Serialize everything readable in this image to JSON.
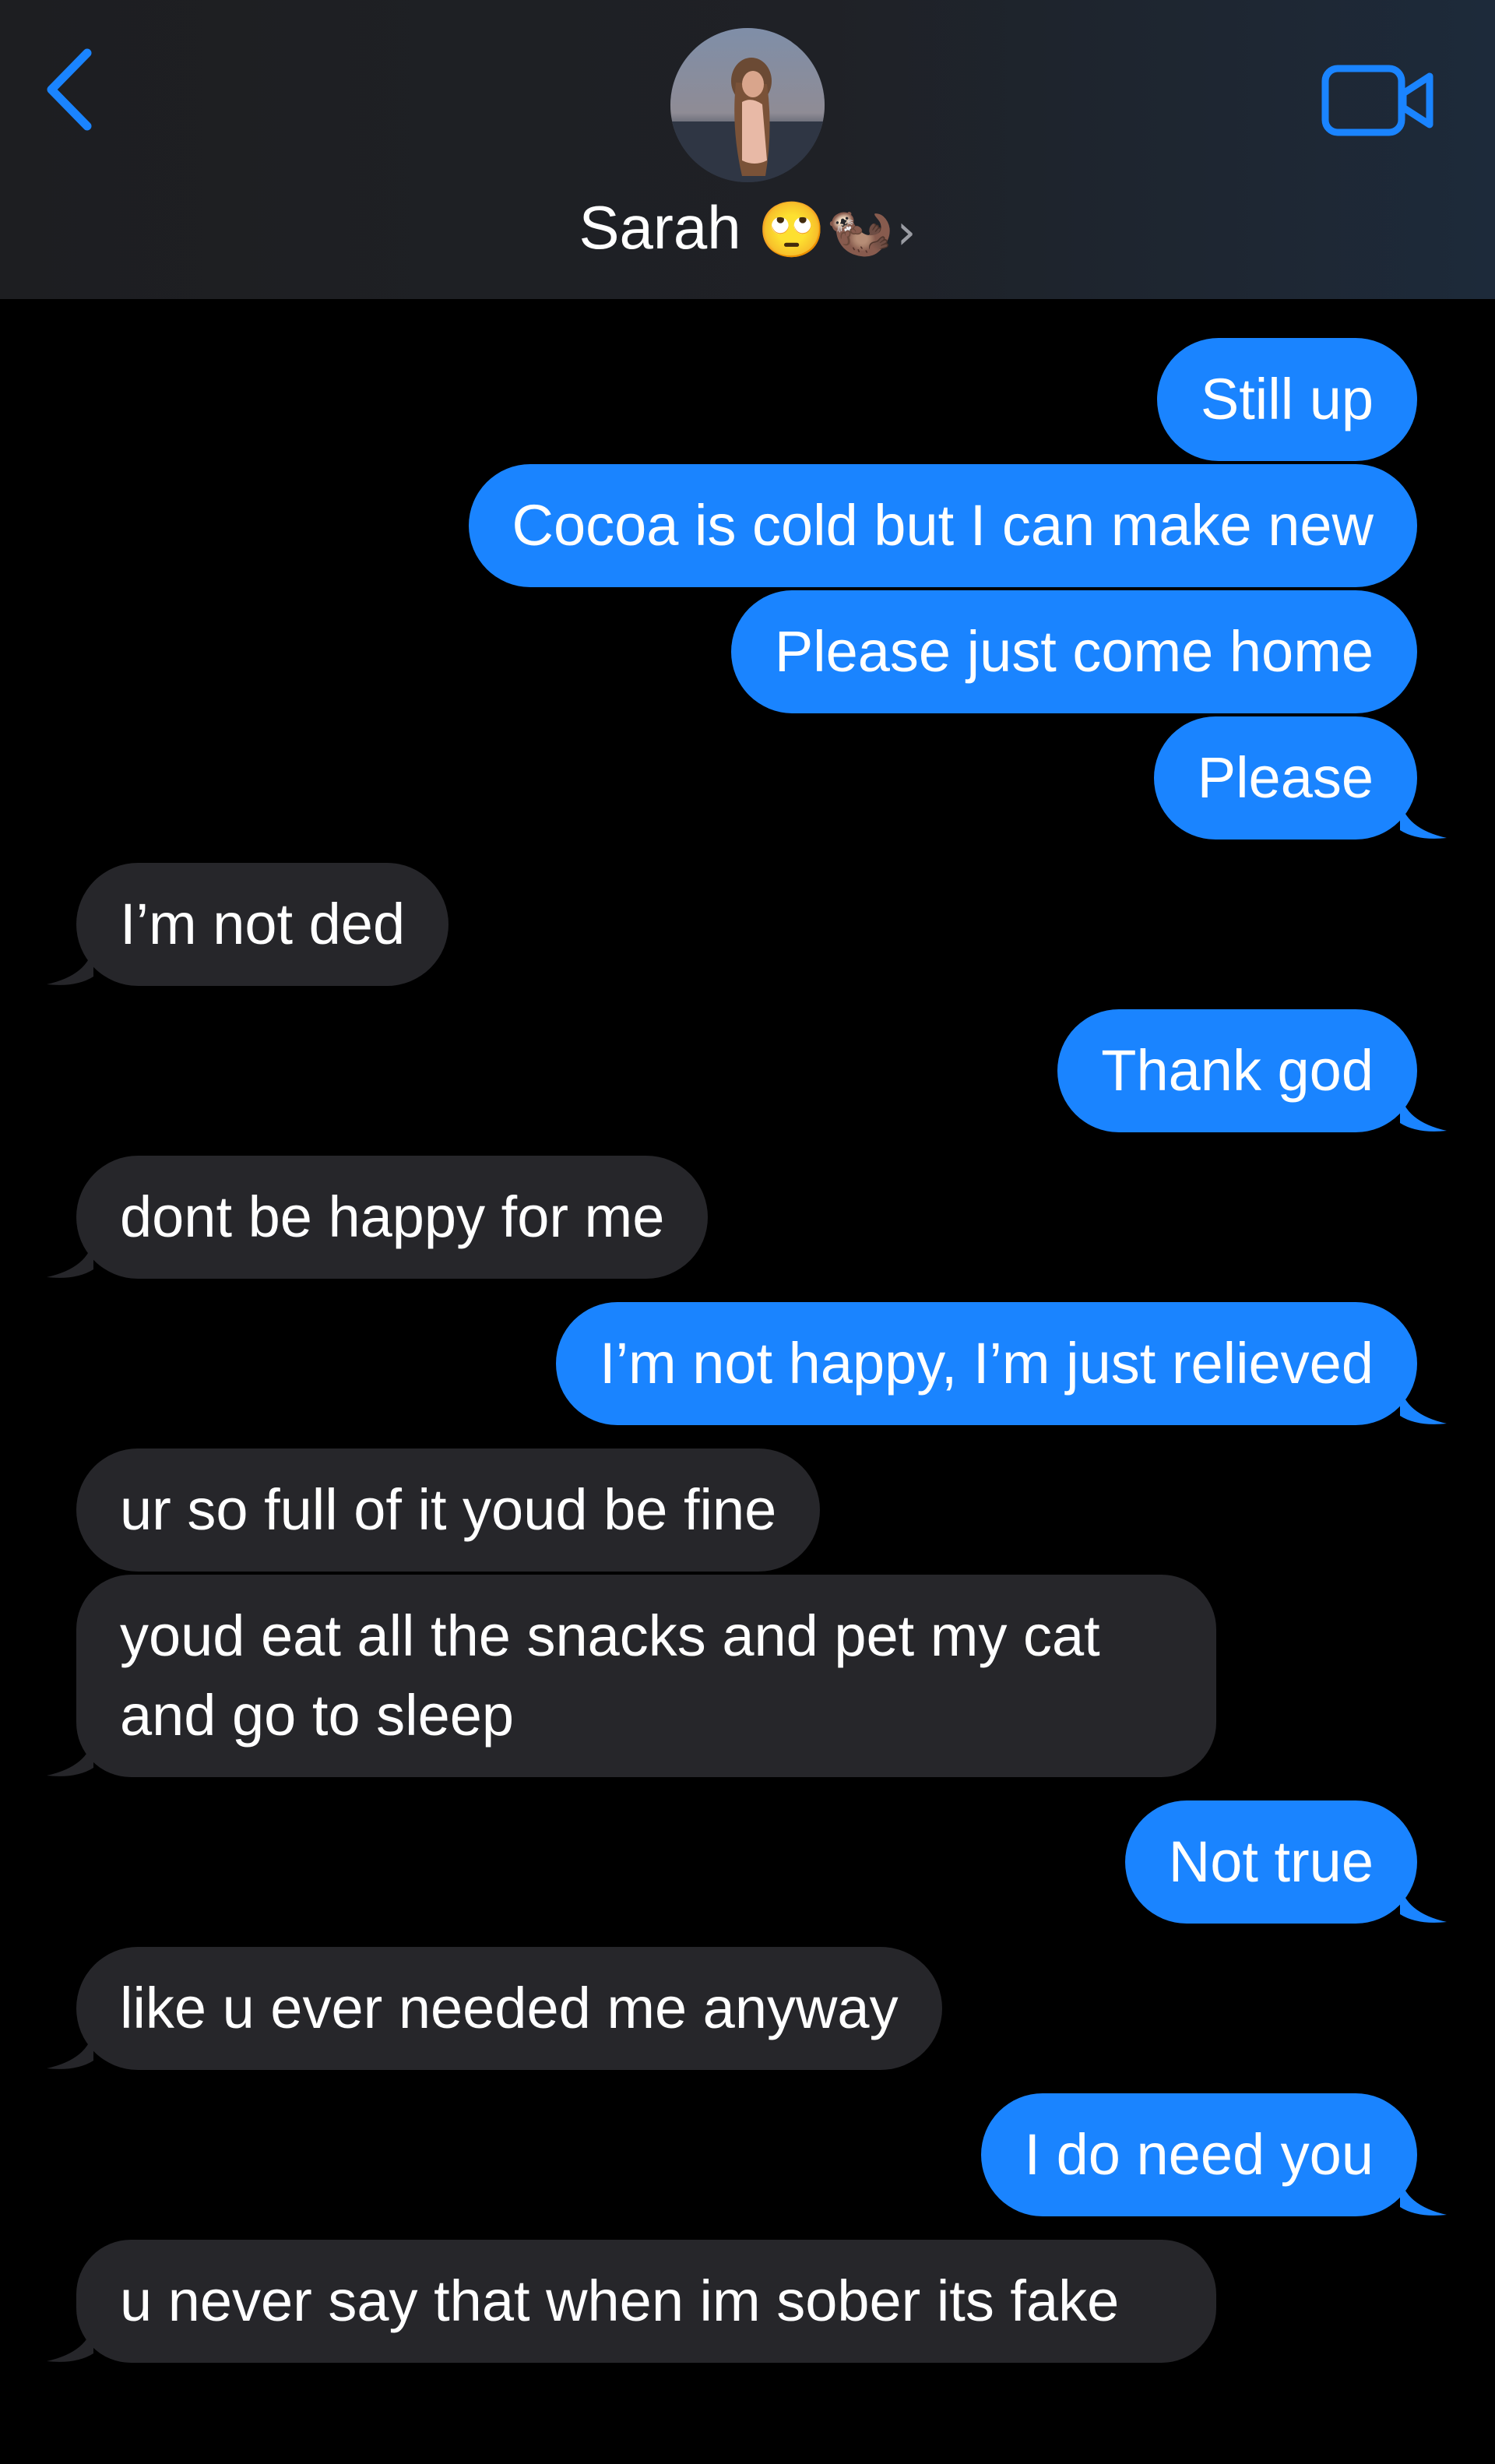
{
  "header": {
    "contact_name": "Sarah",
    "contact_emoji": "🙄🦦",
    "chevron": "›",
    "back_icon": "chevron-left-icon",
    "video_icon": "video-camera-icon",
    "accent_color": "#1a84ff"
  },
  "colors": {
    "sent_bubble": "#1a84ff",
    "received_bubble": "#26262a",
    "background": "#000000"
  },
  "messages": [
    {
      "sender": "me",
      "text": "Still up"
    },
    {
      "sender": "me",
      "text": "Cocoa is cold but I can make new"
    },
    {
      "sender": "me",
      "text": "Please just come home"
    },
    {
      "sender": "me",
      "text": "Please"
    },
    {
      "sender": "them",
      "text": "I’m not ded"
    },
    {
      "sender": "me",
      "text": "Thank god"
    },
    {
      "sender": "them",
      "text": "dont be happy for me"
    },
    {
      "sender": "me",
      "text": "I’m not happy, I’m just relieved"
    },
    {
      "sender": "them",
      "text": "ur so full of it youd be fine"
    },
    {
      "sender": "them",
      "text": "youd eat all the snacks and pet my cat and go to sleep"
    },
    {
      "sender": "me",
      "text": "Not true"
    },
    {
      "sender": "them",
      "text": "like u ever needed me anyway"
    },
    {
      "sender": "me",
      "text": "I do need you"
    },
    {
      "sender": "them",
      "text": "u never say that when im sober its fake"
    }
  ]
}
